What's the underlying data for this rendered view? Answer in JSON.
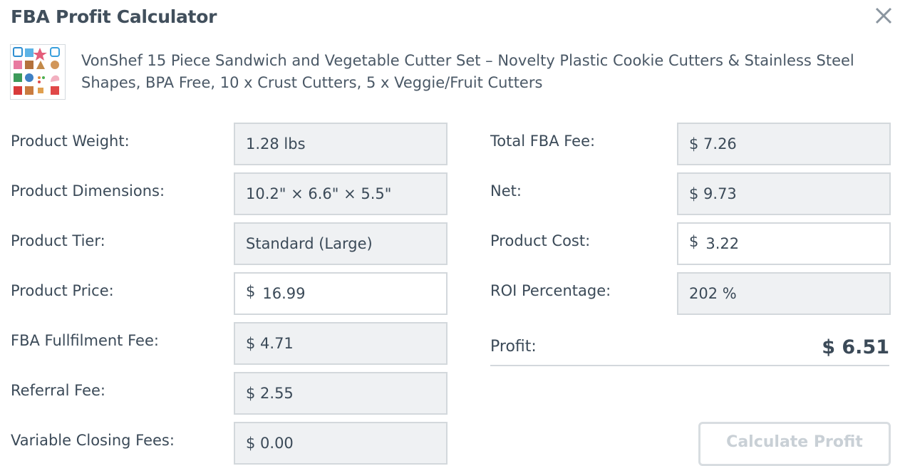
{
  "header": {
    "title": "FBA Profit Calculator",
    "close_icon": "close-icon"
  },
  "product": {
    "thumbnail_icon": "product-thumbnail",
    "title": "VonShef 15 Piece Sandwich and Vegetable Cutter Set – Novelty Plastic Cookie Cutters & Stainless Steel Shapes, BPA Free, 10 x Crust Cutters, 5 x Veggie/Fruit Cutters"
  },
  "left": {
    "weight": {
      "label": "Product Weight:",
      "value": "1.28 lbs"
    },
    "dimensions": {
      "label": "Product Dimensions:",
      "value": "10.2\" × 6.6\" × 5.5\""
    },
    "tier": {
      "label": "Product Tier:",
      "value": "Standard (Large)"
    },
    "price": {
      "label": "Product Price:",
      "currency": "$",
      "value": "16.99"
    },
    "fulfilment_fee": {
      "label": "FBA Fullfilment Fee:",
      "value": "$ 4.71"
    },
    "referral_fee": {
      "label": "Referral Fee:",
      "value": "$ 2.55"
    },
    "closing_fees": {
      "label": "Variable Closing Fees:",
      "value": "$ 0.00"
    }
  },
  "right": {
    "total_fee": {
      "label": "Total FBA Fee:",
      "value": "$ 7.26"
    },
    "net": {
      "label": "Net:",
      "value": "$ 9.73"
    },
    "cost": {
      "label": "Product Cost:",
      "currency": "$",
      "value": "3.22"
    },
    "roi": {
      "label": "ROI Percentage:",
      "value": "202 %"
    },
    "profit": {
      "label": "Profit:",
      "value": "$ 6.51"
    }
  },
  "actions": {
    "calculate_label": "Calculate Profit"
  },
  "colors": {
    "text": "#3b4a58",
    "field_bg": "#eff1f3",
    "border": "#d3d8dc",
    "disabled_text": "#c9d0d6"
  }
}
